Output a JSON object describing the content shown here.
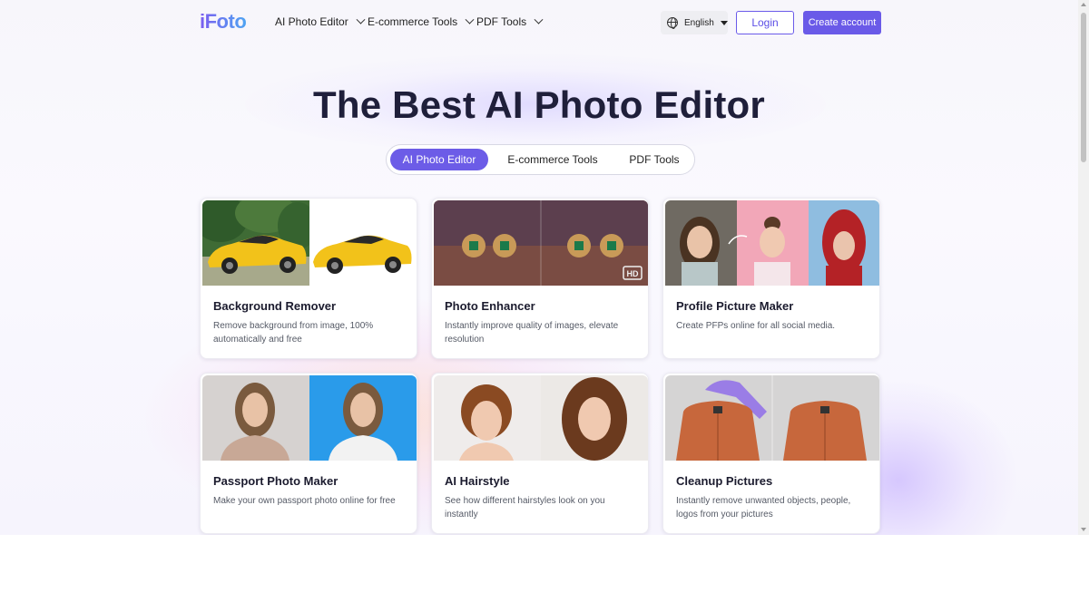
{
  "header": {
    "logo": "iFoto",
    "nav": [
      {
        "label": "AI Photo Editor"
      },
      {
        "label": "E-commerce Tools"
      },
      {
        "label": "PDF Tools"
      }
    ],
    "language": "English",
    "login": "Login",
    "create_account": "Create account"
  },
  "hero": {
    "title": "The Best AI Photo Editor",
    "tabs": [
      {
        "label": "AI Photo Editor",
        "active": true
      },
      {
        "label": "E-commerce Tools",
        "active": false
      },
      {
        "label": "PDF Tools",
        "active": false
      }
    ]
  },
  "cards": [
    {
      "title": "Background Remover",
      "desc": "Remove background from image, 100% automatically and free"
    },
    {
      "title": "Photo Enhancer",
      "desc": "Instantly improve quality of images, elevate resolution",
      "badge": "HD"
    },
    {
      "title": "Profile Picture Maker",
      "desc": "Create PFPs online for all social media."
    },
    {
      "title": "Passport Photo Maker",
      "desc": "Make your own passport photo online for free"
    },
    {
      "title": "AI Hairstyle",
      "desc": "See how different hairstyles look on you instantly"
    },
    {
      "title": "Cleanup Pictures",
      "desc": "Instantly remove unwanted objects, people, logos from your pictures"
    }
  ],
  "colors": {
    "accent": "#6a5ae8",
    "title": "#1f1f3a"
  }
}
